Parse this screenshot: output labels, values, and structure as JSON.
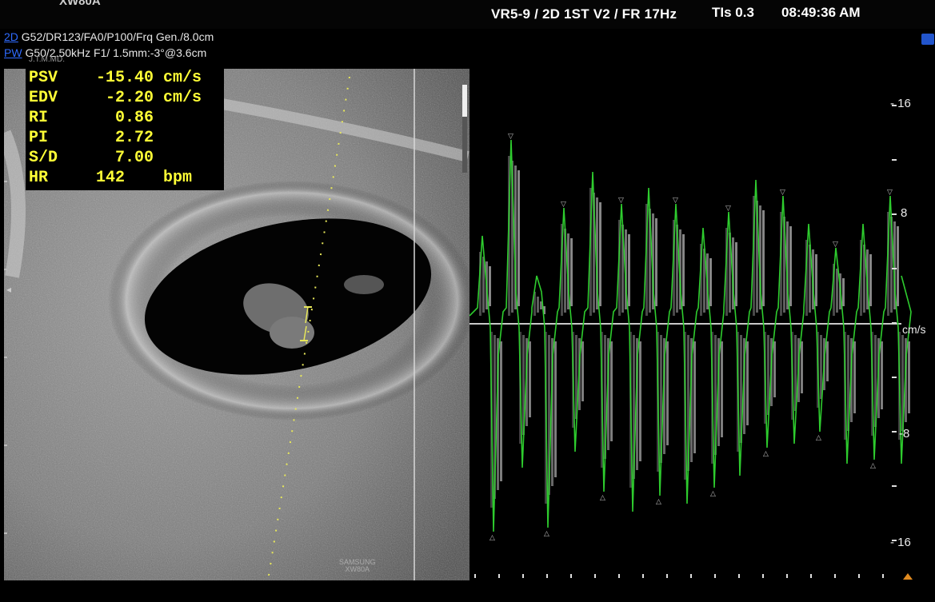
{
  "header": {
    "model": "XW80A",
    "mode": "VR5-9 / 2D 1ST V2 / FR 17Hz",
    "tis": "TIs 0.3",
    "time": "08:49:36 AM"
  },
  "params": {
    "tag_2d": "2D",
    "line_2d": "G52/DR123/FA0/P100/Frq Gen./8.0cm",
    "tag_pw": "PW",
    "line_pw": "G50/2.50kHz F1/ 1.5mm:-3°@3.6cm",
    "subtitle": "J.T.M.MD."
  },
  "measurements": [
    {
      "label": "PSV",
      "value": "-15.40 cm/s"
    },
    {
      "label": "EDV",
      "value": " -2.20 cm/s"
    },
    {
      "label": "RI",
      "value": "  0.86"
    },
    {
      "label": "PI",
      "value": "  2.72"
    },
    {
      "label": "S/D",
      "value": "  7.00"
    },
    {
      "label": "HR",
      "value": "142    bpm"
    }
  ],
  "logo": {
    "line1": "SAMSUNG",
    "line2": "XW80A"
  },
  "doppler": {
    "unit": "cm/s",
    "scale_labels": [
      "- 16",
      "8",
      "-8",
      "- 16"
    ],
    "waveform_color": "#2ecc2e",
    "baseline_color": "#c8c8c8"
  }
}
